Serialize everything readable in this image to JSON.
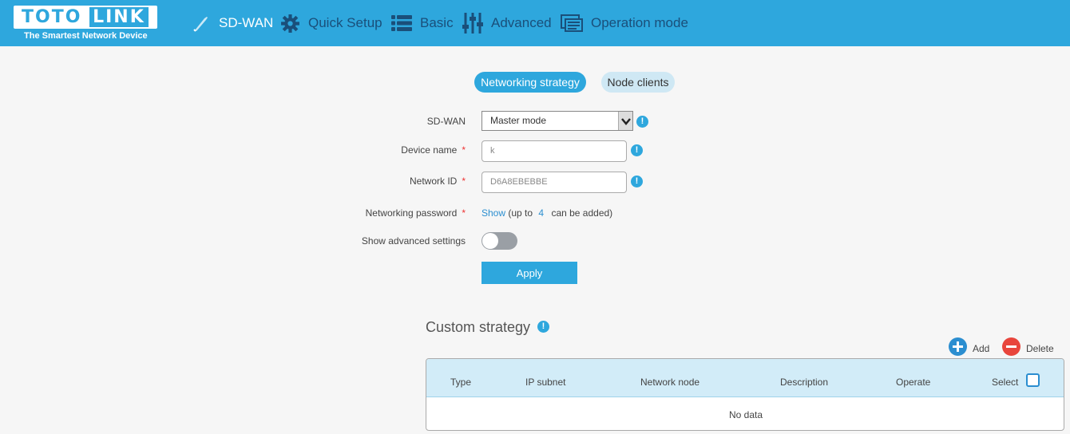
{
  "brand": {
    "logo_left": "TOTO",
    "logo_right": "LINK",
    "tagline": "The Smartest Network Device",
    "color": "#2ea7dd"
  },
  "nav": {
    "items": [
      {
        "label": "SD-WAN",
        "icon": "wrench-icon",
        "active": true
      },
      {
        "label": "Quick Setup",
        "icon": "gear-icon"
      },
      {
        "label": "Basic",
        "icon": "list-icon"
      },
      {
        "label": "Advanced",
        "icon": "sliders-icon"
      },
      {
        "label": "Operation mode",
        "icon": "mode-icon"
      }
    ]
  },
  "tabs": {
    "networking_strategy": "Networking strategy",
    "node_clients": "Node clients"
  },
  "form": {
    "sdwan_label": "SD-WAN",
    "sdwan_value": "Master mode",
    "device_name_label": "Device name",
    "device_name_value": "k",
    "network_id_label": "Network ID",
    "network_id_value": "D6A8EBEBBE",
    "password_label": "Networking password",
    "password_show": "Show",
    "password_note_pre": "(up to",
    "password_count": "4",
    "password_note_post": "can be added)",
    "advanced_label": "Show advanced settings",
    "advanced_enabled": false,
    "required_mark": "*",
    "info_mark": "!",
    "apply_label": "Apply"
  },
  "custom_strategy": {
    "title": "Custom strategy",
    "add_label": "Add",
    "delete_label": "Delete",
    "columns": [
      "Type",
      "IP subnet",
      "Network node",
      "Description",
      "Operate",
      "Select"
    ],
    "empty_text": "No data"
  }
}
